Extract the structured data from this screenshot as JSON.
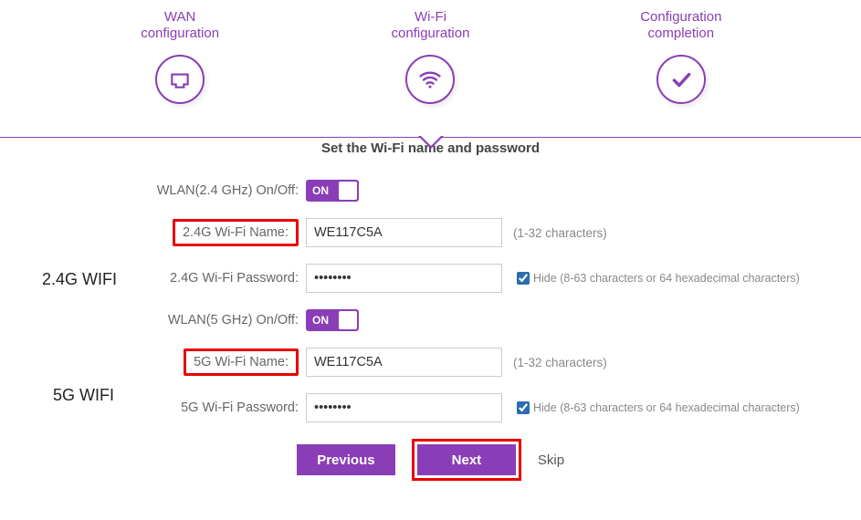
{
  "steps": {
    "wan": {
      "line1": "WAN",
      "line2": "configuration"
    },
    "wifi": {
      "line1": "Wi-Fi",
      "line2": "configuration"
    },
    "complete": {
      "line1": "Configuration",
      "line2": "completion"
    }
  },
  "title": "Set the Wi-Fi name and password",
  "wlan24": {
    "label": "WLAN(2.4 GHz) On/Off:",
    "toggle_text": "ON",
    "name_label": "2.4G Wi-Fi Name:",
    "name_value": "WE117C5A",
    "name_help": "(1-32 characters)",
    "pwd_label": "2.4G Wi-Fi Password:",
    "pwd_value": "••••••••",
    "hide_label": "Hide",
    "pwd_help": "(8-63 characters or 64 hexadecimal characters)"
  },
  "wlan5": {
    "label": "WLAN(5 GHz) On/Off:",
    "toggle_text": "ON",
    "name_label": "5G Wi-Fi Name:",
    "name_value": "WE117C5A",
    "name_help": "(1-32 characters)",
    "pwd_label": "5G Wi-Fi Password:",
    "pwd_value": "••••••••",
    "hide_label": "Hide",
    "pwd_help": "(8-63 characters or 64 hexadecimal characters)"
  },
  "buttons": {
    "prev": "Previous",
    "next": "Next",
    "skip": "Skip"
  },
  "annot": {
    "g24": "2.4G WIFI",
    "g5": "5G WIFI"
  }
}
